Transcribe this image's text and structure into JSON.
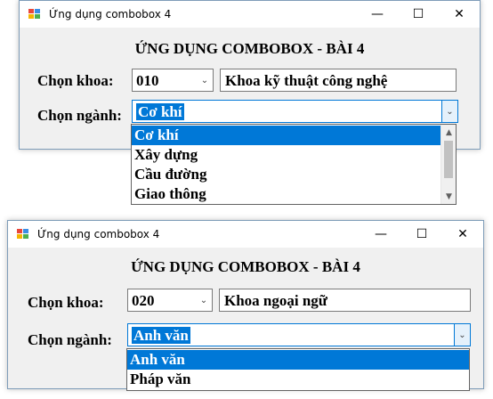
{
  "colors": {
    "accent": "#0078d7",
    "window_bg": "#f0f0f0",
    "titlebar_bg": "#ffffff"
  },
  "window1": {
    "title": "Ứng dụng combobox 4",
    "heading": "ỨNG DỤNG COMBOBOX - BÀI 4",
    "khoa_label": "Chọn khoa:",
    "khoa_value": "010",
    "khoa_name": "Khoa kỹ thuật công nghệ",
    "nganh_label": "Chọn ngành:",
    "nganh_value": "Cơ khí",
    "dropdown_items": [
      "Cơ khí",
      "Xây dựng",
      "Cầu đường",
      "Giao thông"
    ],
    "selected_index": 0
  },
  "window2": {
    "title": "Ứng dụng combobox 4",
    "heading": "ỨNG DỤNG COMBOBOX - BÀI 4",
    "khoa_label": "Chọn khoa:",
    "khoa_value": "020",
    "khoa_name": "Khoa ngoại ngữ",
    "nganh_label": "Chọn ngành:",
    "nganh_value": "Anh văn",
    "dropdown_items": [
      "Anh văn",
      "Pháp văn"
    ],
    "selected_index": 0
  },
  "titlebar_buttons": {
    "minimize": "—",
    "maximize": "☐",
    "close": "✕"
  },
  "icons": {
    "dropdown_arrow": "chevron-down-icon",
    "scroll_up": "scroll-up-arrow-icon",
    "scroll_down": "scroll-down-arrow-icon"
  }
}
